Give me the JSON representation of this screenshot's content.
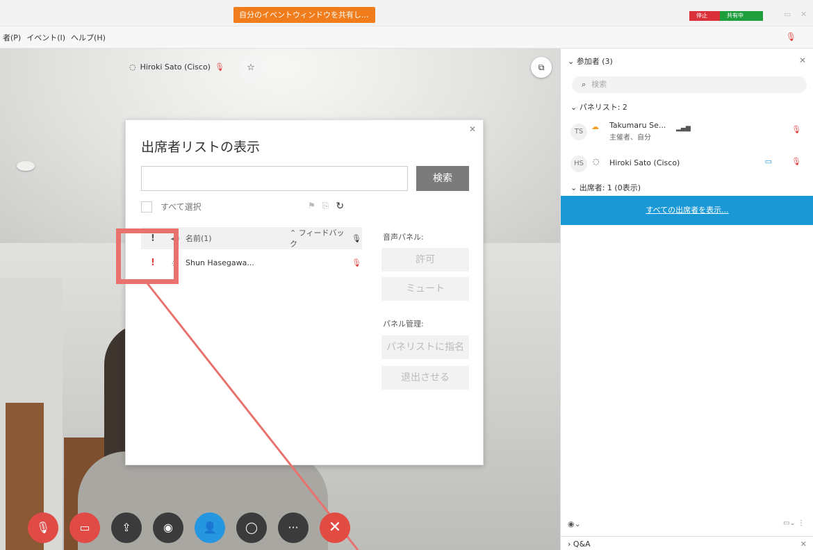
{
  "titlebar": {
    "share_banner": "自分のイベントウィンドウを共有し...",
    "stop_label": "停止",
    "sharing_label": "共有中"
  },
  "menubar": {
    "items": [
      "者(P)",
      "イベント(I)",
      "ヘルプ(H)"
    ]
  },
  "video": {
    "speaker_name": "Hiroki Sato (Cisco)"
  },
  "dialog": {
    "title": "出席者リストの表示",
    "search_placeholder": "",
    "search_button": "検索",
    "select_all": "すべて選択",
    "columns": {
      "excl": "!",
      "name": "名前(1)",
      "feedback": "フィードバック"
    },
    "rows": [
      {
        "excl": "!",
        "name": "Shun Hasegawa..."
      }
    ],
    "audio_panel_label": "音声パネル:",
    "allow_button": "許可",
    "mute_button": "ミュート",
    "panel_mgmt_label": "パネル管理:",
    "assign_panelist_button": "パネリストに指名",
    "expel_button": "退出させる",
    "colors": {
      "excl_header": "#555555",
      "excl_row": "#e0403a"
    }
  },
  "right_panel": {
    "header": "参加者 (3)",
    "search_placeholder": "検索",
    "panelists_section": "パネリスト: 2",
    "panelists": [
      {
        "initials": "TS",
        "name": "Takumaru Se...",
        "role": "主催者、自分"
      },
      {
        "initials": "HS",
        "name": "Hiroki Sato (Cisco)",
        "role": ""
      }
    ],
    "attendees_section": "出席者: 1 (0表示)",
    "show_all_link": "すべての出席者を表示...",
    "qa_label": "Q&A"
  },
  "colors": {
    "accent_blue": "#1a98d5",
    "highlight": "#e8736e",
    "share_orange": "#f07c1b",
    "stop_red": "#d9303a",
    "sharing_green": "#1f9e3e"
  }
}
